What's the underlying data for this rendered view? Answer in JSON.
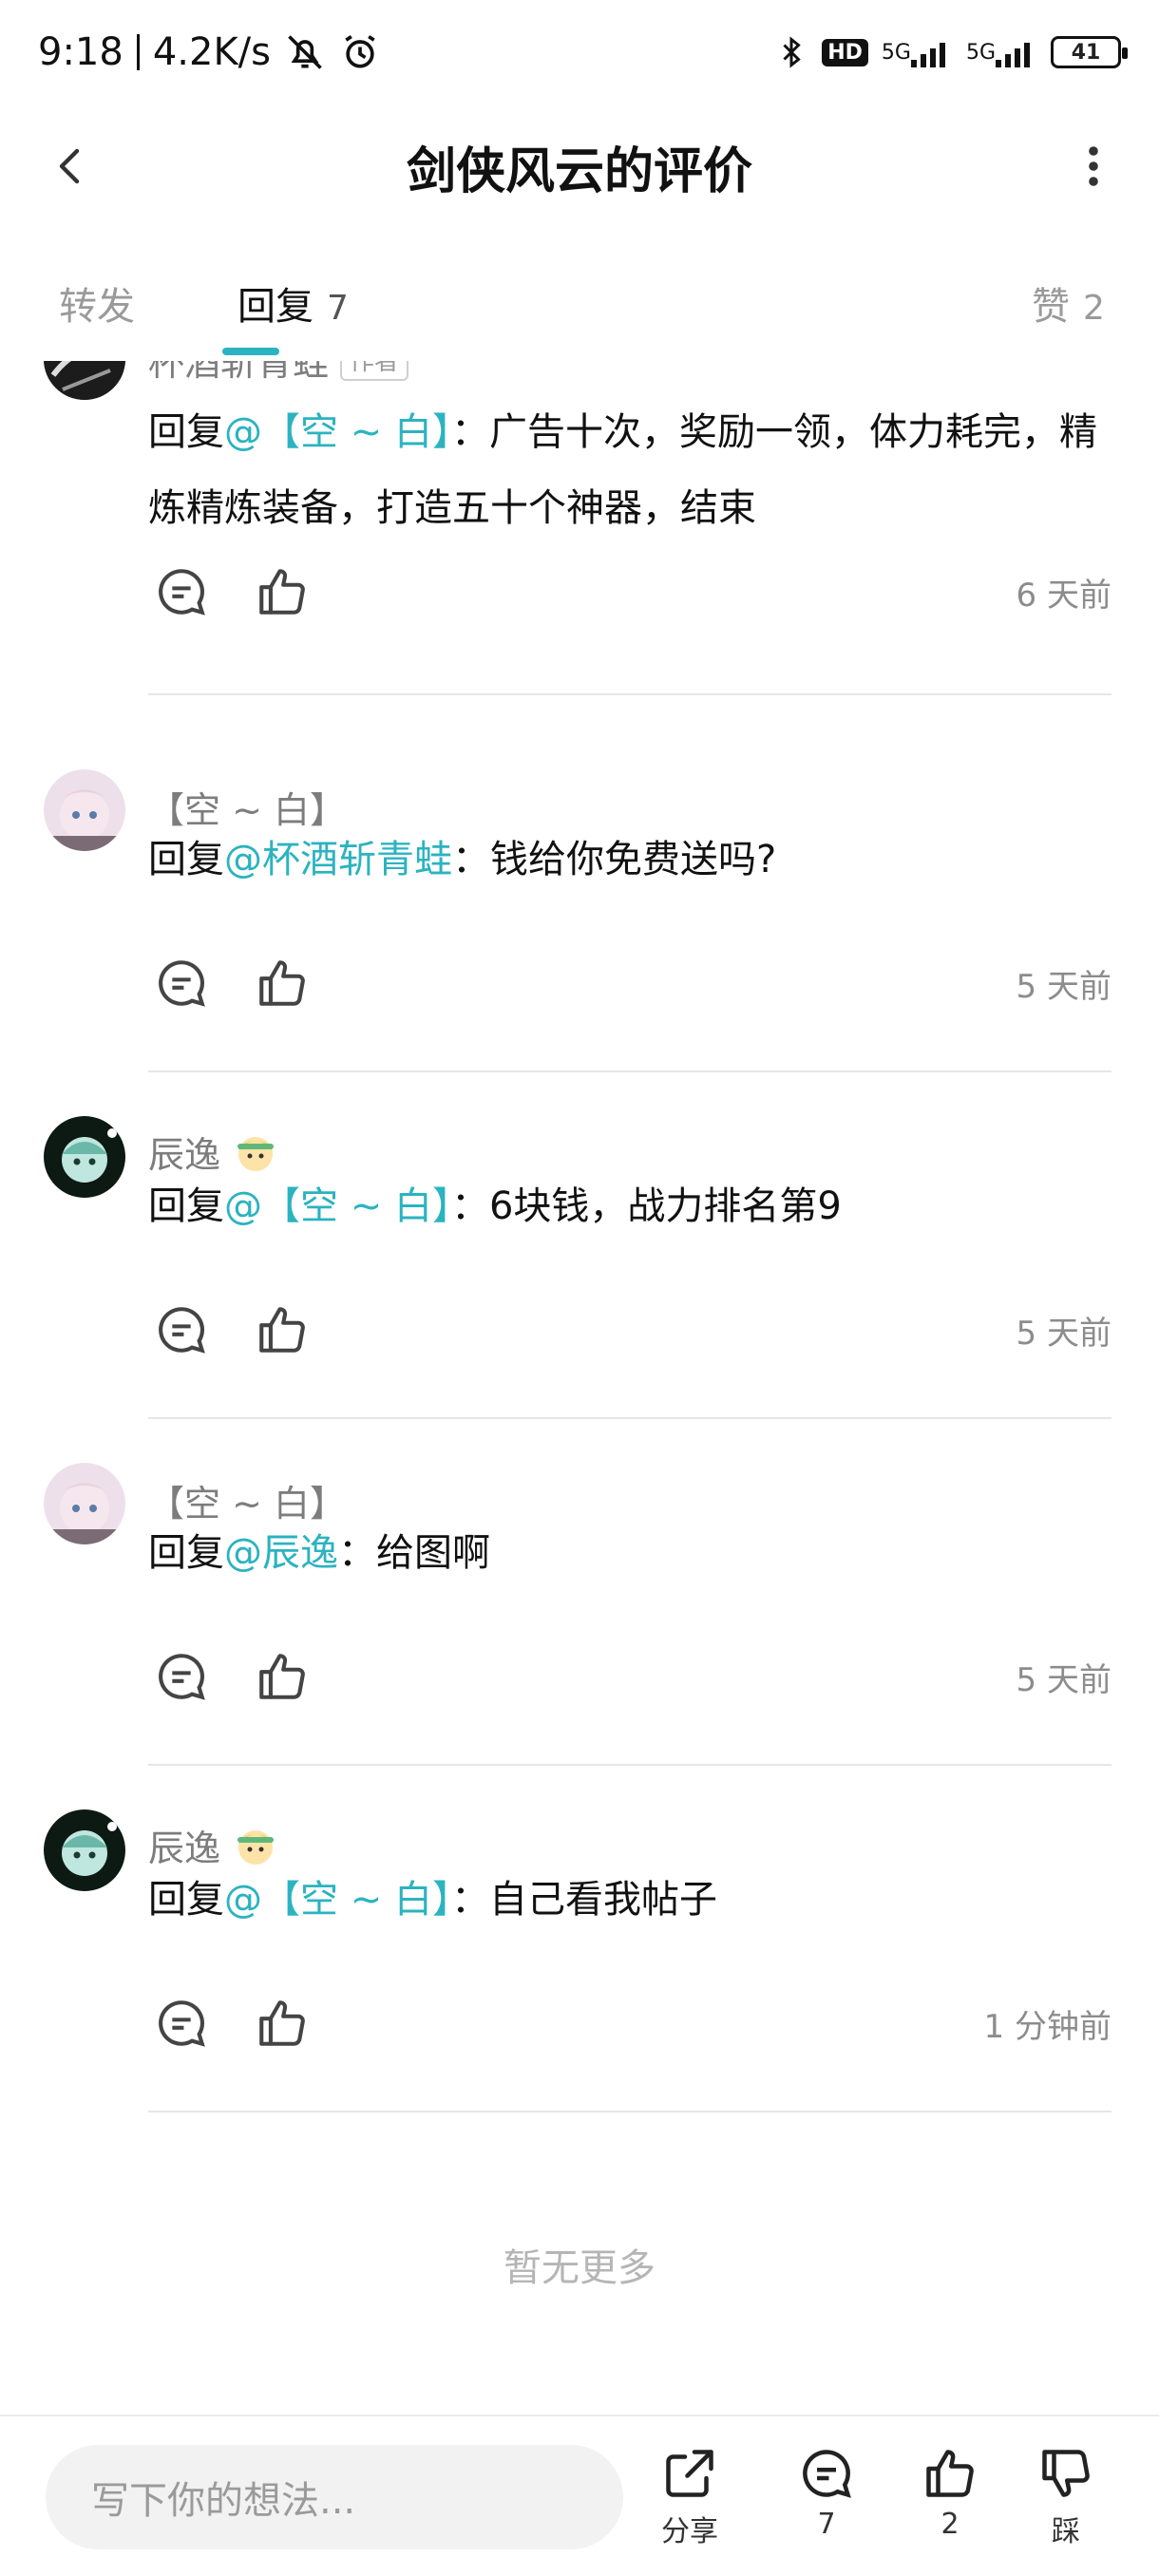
{
  "status_bar": {
    "time": "9:18",
    "speed": "4.2K/s",
    "hd": "HD",
    "net1": "5G",
    "net2": "5G",
    "battery": "41"
  },
  "header": {
    "title": "剑侠风云的评价"
  },
  "tabs": [
    {
      "label": "转发",
      "count": ""
    },
    {
      "label": "回复",
      "count": "7"
    },
    {
      "label": "赞",
      "count": "2"
    }
  ],
  "comments": [
    {
      "author": "杯酒斩青蛙",
      "badge": "作者",
      "prefix": "回复",
      "mention": "@【空 ~ 白】",
      "text": "：广告十次，奖励一领，体力耗完，精炼精炼装备，打造五十个神器，结束",
      "time": "6 天前"
    },
    {
      "author": "【空 ~ 白】",
      "prefix": "回复",
      "mention": "@杯酒斩青蛙",
      "text": "：钱给你免费送吗?",
      "time": "5 天前"
    },
    {
      "author": "辰逸",
      "prefix": "回复",
      "mention": "@【空 ~ 白】",
      "text": "：6块钱，战力排名第9",
      "time": "5 天前"
    },
    {
      "author": "【空 ~ 白】",
      "prefix": "回复",
      "mention": "@辰逸",
      "text": "：给图啊",
      "time": "5 天前"
    },
    {
      "author": "辰逸",
      "prefix": "回复",
      "mention": "@【空 ~ 白】",
      "text": "：自己看我帖子",
      "time": "1 分钟前"
    }
  ],
  "footer_note": "暂无更多",
  "bottom_bar": {
    "input_placeholder": "写下你的想法...",
    "share_label": "分享",
    "comment_count": "7",
    "like_count": "2",
    "dislike_label": "踩"
  },
  "colors": {
    "accent": "#2bb3c0",
    "text": "#111111",
    "muted": "#8c8c8c"
  }
}
